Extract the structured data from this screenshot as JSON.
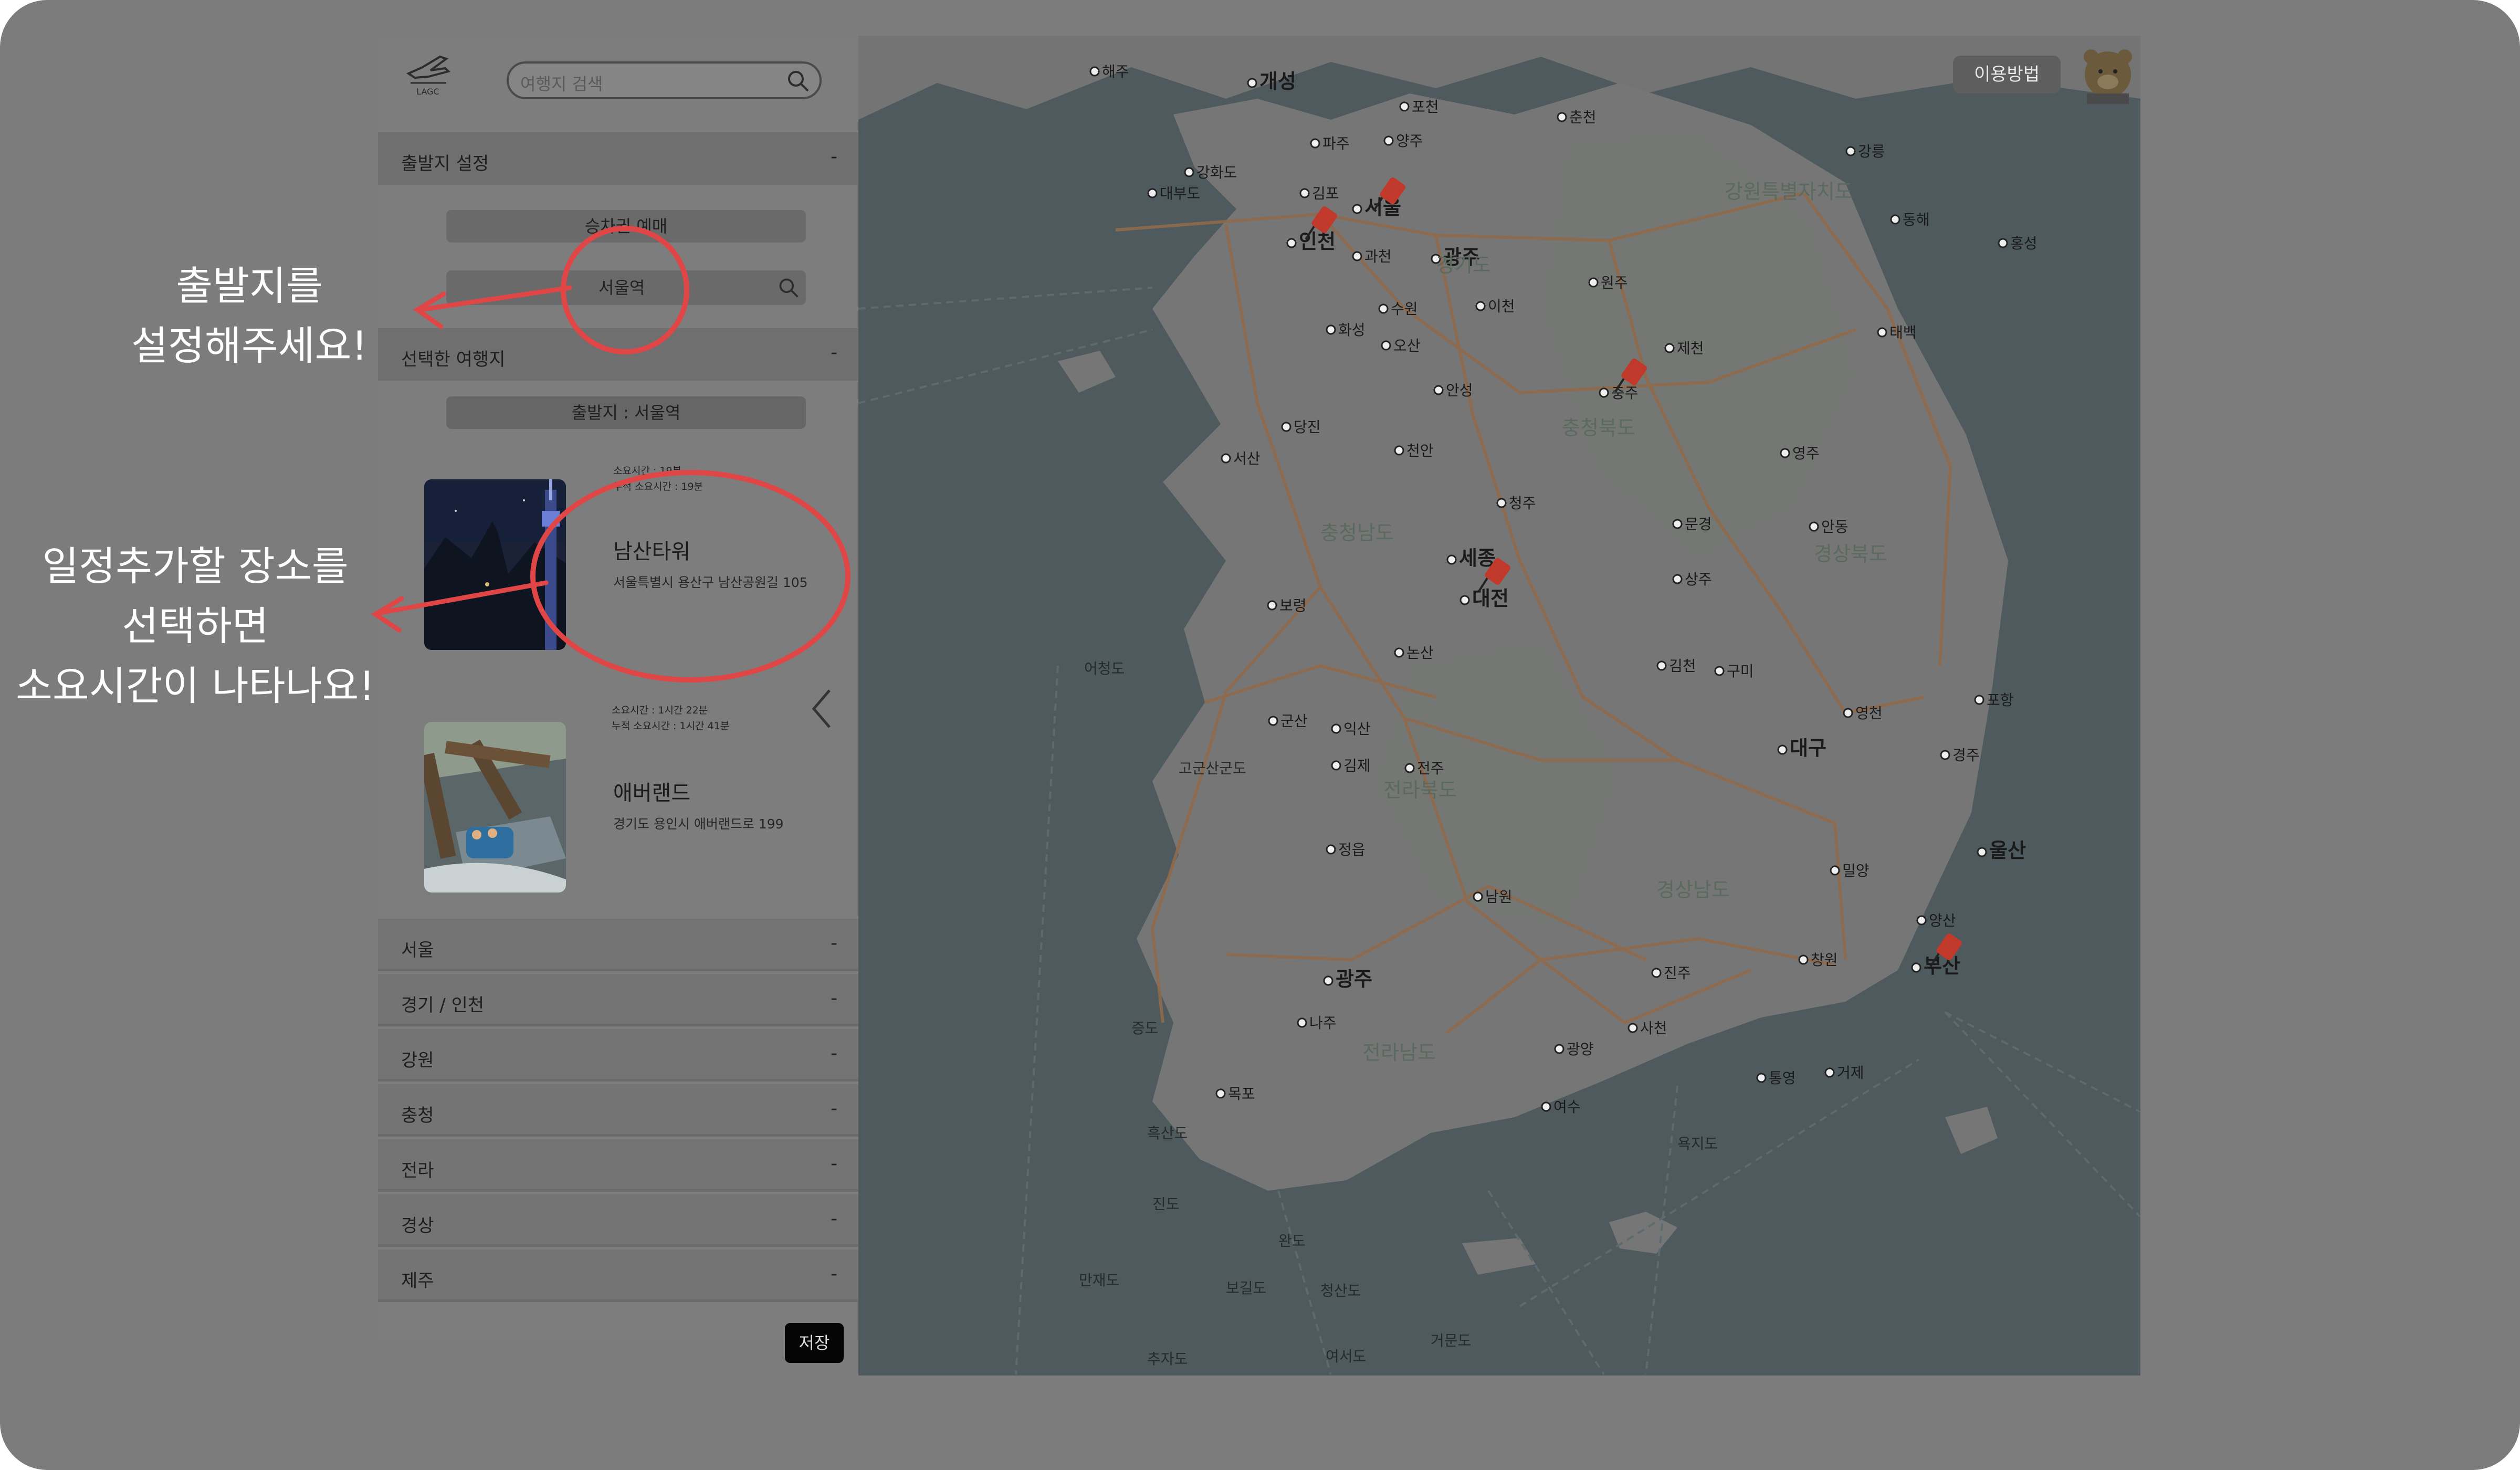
{
  "sidebar": {
    "search_placeholder": "여행지 검색",
    "departure_section": {
      "label": "출발지 설정",
      "toggle": "-"
    },
    "transport_label": "승차권 예매",
    "departure_input": "서울역",
    "selected_section": {
      "label": "선택한 여행지",
      "toggle": "-"
    },
    "departure_summary": "출발지 : 서울역",
    "places": [
      {
        "time": "소요시간 : 19분",
        "cumulative": "누적 소요시간 : 19분",
        "name": "남산타워",
        "address": "서울특별시 용산구 남산공원길 105"
      },
      {
        "time": "소요시간 : 1시간 22분",
        "cumulative": "누적 소요시간 : 1시간 41분",
        "name": "애버랜드",
        "address": "경기도 용인시 애버랜드로 199"
      }
    ],
    "regions": [
      {
        "label": "서울",
        "toggle": "-"
      },
      {
        "label": "경기 / 인천",
        "toggle": "-"
      },
      {
        "label": "강원",
        "toggle": "-"
      },
      {
        "label": "충청",
        "toggle": "-"
      },
      {
        "label": "전라",
        "toggle": "-"
      },
      {
        "label": "경상",
        "toggle": "-"
      },
      {
        "label": "제주",
        "toggle": "-"
      }
    ],
    "save_label": "저장"
  },
  "map": {
    "usage_button": "이용방법",
    "cities": [
      "개성",
      "포천",
      "춘천",
      "강릉",
      "파주",
      "양주",
      "김포",
      "서울",
      "인천",
      "과천",
      "광주",
      "수원",
      "이천",
      "화성",
      "오산",
      "원주",
      "안성",
      "제천",
      "충주",
      "당진",
      "천안",
      "서산",
      "청주",
      "세종",
      "대전",
      "문경",
      "상주",
      "영주",
      "안동",
      "보령",
      "논산",
      "김천",
      "구미",
      "군산",
      "익산",
      "김제",
      "전주",
      "대구",
      "영천",
      "포항",
      "경주",
      "정읍",
      "남원",
      "울산",
      "밀양",
      "양산",
      "부산",
      "창원",
      "진주",
      "광주",
      "나주",
      "사천",
      "광양",
      "통영",
      "거제",
      "목포",
      "여수",
      "해주",
      "태백",
      "동해",
      "홍성",
      "대부도",
      "강화도"
    ],
    "provinces": [
      "강원특별자치도",
      "경기도",
      "충청북도",
      "충청남도",
      "경상북도",
      "전라북도",
      "경상남도",
      "전라남도"
    ],
    "sea_labels": [
      "어청도",
      "고군산군도",
      "증도",
      "흑산도",
      "진도",
      "완도",
      "보길도",
      "만재도",
      "추자도",
      "청산도",
      "거문도",
      "여서도",
      "욕지도"
    ]
  },
  "annotations": {
    "departure_hint": [
      "출발지를",
      "설정해주세요!"
    ],
    "place_hint": [
      "일정추가할 장소를",
      "선택하면",
      "소요시간이 나타나요!"
    ]
  },
  "colors": {
    "overlay": "#7c7c7c",
    "highlight": "#e04646",
    "pin": "#c0392b",
    "road": "#b6743f"
  }
}
